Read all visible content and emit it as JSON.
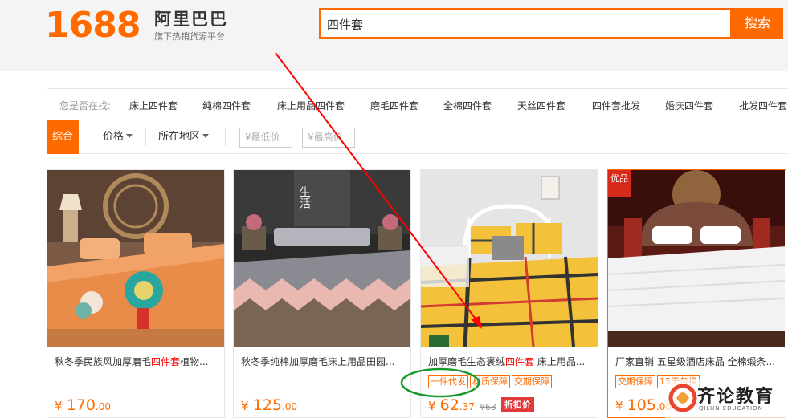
{
  "header": {
    "logo_number": "1688",
    "logo_brand": "阿里巴巴",
    "logo_tagline": "旗下热销货源平台"
  },
  "search": {
    "value": "四件套",
    "button_label": "搜索"
  },
  "suggestions": {
    "label": "您是否在找:",
    "items": [
      "床上四件套",
      "纯棉四件套",
      "床上用品四件套",
      "磨毛四件套",
      "全棉四件套",
      "天丝四件套",
      "四件套批发",
      "婚庆四件套",
      "批发四件套"
    ]
  },
  "filters": {
    "active": "综合",
    "price_label": "价格",
    "region_label": "所在地区",
    "min_price_placeholder": "¥最低价",
    "dash": "-",
    "max_price_placeholder": "¥最高价"
  },
  "products": [
    {
      "title_before": "秋冬季民族风加厚磨毛",
      "title_highlight": "四件套",
      "title_after": "植物...",
      "tags": [],
      "price_symbol": "¥",
      "price_int": "170",
      "price_dec": ".00",
      "old_price": "",
      "discount": ""
    },
    {
      "title_before": "秋冬季纯棉加厚磨毛床上用品田园...",
      "title_highlight": "",
      "title_after": "",
      "tags": [],
      "price_symbol": "¥",
      "price_int": "125",
      "price_dec": ".00",
      "old_price": "",
      "discount": ""
    },
    {
      "title_before": "加厚磨毛生态裹绒",
      "title_highlight": "四件套",
      "title_after": " 床上用品...",
      "tags": [
        "一件代发",
        "材质保障",
        "交期保障"
      ],
      "price_symbol": "¥",
      "price_int": "62",
      "price_dec": ".37",
      "old_price": "¥63",
      "discount": "折扣价"
    },
    {
      "title_before": "厂家直销 五星级酒店床品 全棉缎条...",
      "title_highlight": "",
      "title_after": "",
      "tags": [
        "交期保障",
        "15天包换"
      ],
      "price_symbol": "¥",
      "price_int": "105",
      "price_dec": ".00",
      "old_price": "",
      "discount": ""
    }
  ],
  "badges": {
    "card2_vertical_text": "生活",
    "card4_corner_text": "优品"
  },
  "watermark": {
    "text": "齐论教育",
    "sub": "QILUN EDUCATION"
  },
  "colors": {
    "accent": "#ff6a00",
    "highlight_red": "#ff0000",
    "discount_red": "#e4393c",
    "annotation_arrow": "#ff0000",
    "annotation_circle": "#1a9a2e"
  }
}
